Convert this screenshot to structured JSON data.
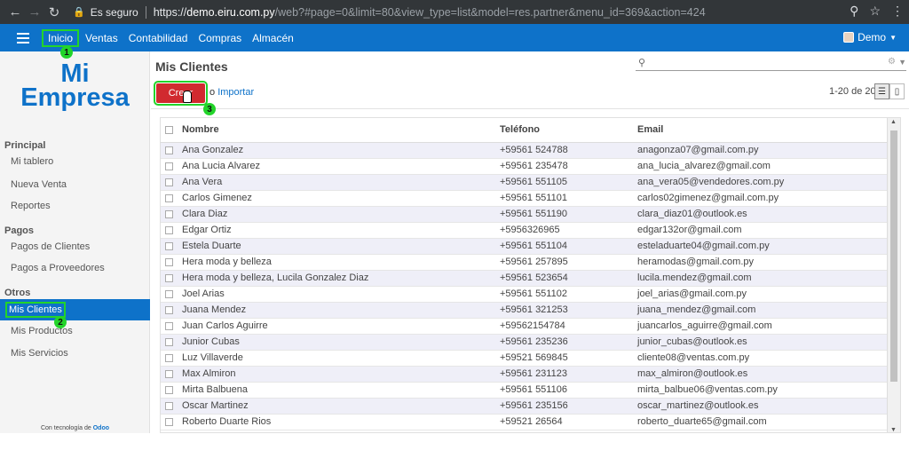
{
  "browser": {
    "secure_label": "Es seguro",
    "url_scheme": "https://",
    "url_host": "demo.eiru.com.py",
    "url_rest": "/web?#page=0&limit=80&view_type=list&model=res.partner&menu_id=369&action=424"
  },
  "topbar": {
    "menu": [
      "Inicio",
      "Ventas",
      "Contabilidad",
      "Compras",
      "Almacén"
    ],
    "user": "Demo"
  },
  "badges": [
    "1",
    "2",
    "3"
  ],
  "sidebar": {
    "logo_line1": "Mi",
    "logo_line2": "Empresa",
    "sections": [
      "Principal",
      "Pagos",
      "Otros"
    ],
    "items": [
      "Mi tablero",
      "Nueva Venta",
      "Reportes",
      "Pagos de Clientes",
      "Pagos a Proveedores",
      "Mis Clientes",
      "Mis Productos",
      "Mis Servicios"
    ],
    "footer_prefix": "Con tecnología de ",
    "footer_brand": "Odoo"
  },
  "main": {
    "title": "Mis Clientes",
    "search_value": "",
    "create_label": "Crear",
    "import_or": "o",
    "import_label": "Importar",
    "pager": "1-20 de 20"
  },
  "table": {
    "headers": [
      "Nombre",
      "Teléfono",
      "Email"
    ],
    "rows": [
      [
        "Ana Gonzalez",
        "+59561 524788",
        "anagonza07@gmail.com.py"
      ],
      [
        "Ana Lucia Alvarez",
        "+59561 235478",
        "ana_lucia_alvarez@gmail.com"
      ],
      [
        "Ana Vera",
        "+59561 551105",
        "ana_vera05@vendedores.com.py"
      ],
      [
        "Carlos Gimenez",
        "+59561 551101",
        "carlos02gimenez@gmail.com.py"
      ],
      [
        "Clara Diaz",
        "+59561 551190",
        "clara_diaz01@outlook.es"
      ],
      [
        "Edgar Ortiz",
        "+5956326965",
        "edgar132or@gmail.com"
      ],
      [
        "Estela Duarte",
        "+59561 551104",
        "esteladuarte04@gmail.com.py"
      ],
      [
        "Hera moda y belleza",
        "+59561 257895",
        "heramodas@gmail.com.py"
      ],
      [
        "Hera moda y belleza, Lucila Gonzalez Diaz",
        "+59561 523654",
        "lucila.mendez@gmail.com"
      ],
      [
        "Joel Arias",
        "+59561 551102",
        "joel_arias@gmail.com.py"
      ],
      [
        "Juana Mendez",
        "+59561 321253",
        "juana_mendez@gmail.com"
      ],
      [
        "Juan Carlos Aguirre",
        "+59562154784",
        "juancarlos_aguirre@gmail.com"
      ],
      [
        "Junior Cubas",
        "+59561 235236",
        "junior_cubas@outlook.es"
      ],
      [
        "Luz Villaverde",
        "+59521 569845",
        "cliente08@ventas.com.py"
      ],
      [
        "Max Almiron",
        "+59561 231123",
        "max_almiron@outlook.es"
      ],
      [
        "Mirta Balbuena",
        "+59561 551106",
        "mirta_balbue06@ventas.com.py"
      ],
      [
        "Oscar Martinez",
        "+59561 235156",
        "oscar_martinez@outlook.es"
      ],
      [
        "Roberto Duarte Rios",
        "+59521 26564",
        "roberto_duarte65@gmail.com"
      ]
    ]
  }
}
